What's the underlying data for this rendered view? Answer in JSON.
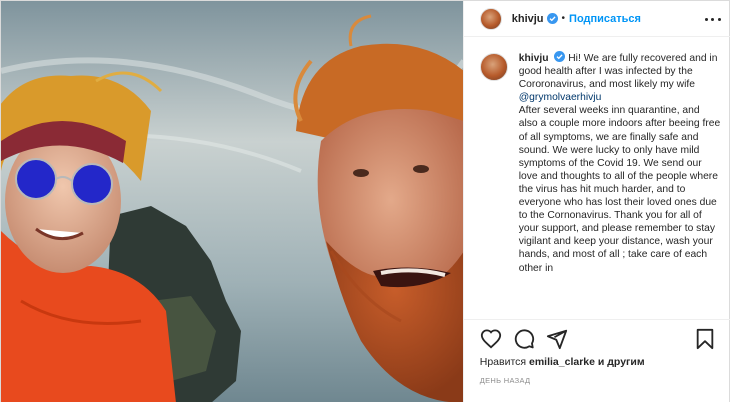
{
  "post": {
    "author": {
      "username": "khivju",
      "verified": true,
      "follow_label": "Подписаться",
      "separator": "•"
    },
    "caption": {
      "username": "khivju",
      "line1": "Hi! We are fully recovered and in good health after I was infected by the Cororonavirus, and most likely my wife ",
      "mention": "@grymolvaerhivju",
      "line2": "After several weeks inn quarantine, and also a couple more indoors after beeing free of all symptoms, we are finally safe and sound. We were lucky to only have mild symptoms of the Covid 19. We send our love and thoughts to all of the people where the virus has hit much harder, and to everyone who has lost their loved ones due to the Cornonavirus. Thank you for all of your support, and please remember to stay vigilant and keep your distance, wash your hands, and most of all ; take care of each other in"
    },
    "likes": {
      "prefix": "Нравится",
      "user": "emilia_clarke",
      "suffix": "и другим"
    },
    "timestamp": "День назад",
    "icons": {
      "like": "heart-icon",
      "comment": "comment-icon",
      "share": "share-icon",
      "save": "bookmark-icon",
      "more": "more-options-icon",
      "verified": "verified-badge-icon"
    },
    "colors": {
      "link": "#0095f6",
      "verified": "#3897f0",
      "mention": "#00376b",
      "muted": "#8e8e8e"
    }
  }
}
